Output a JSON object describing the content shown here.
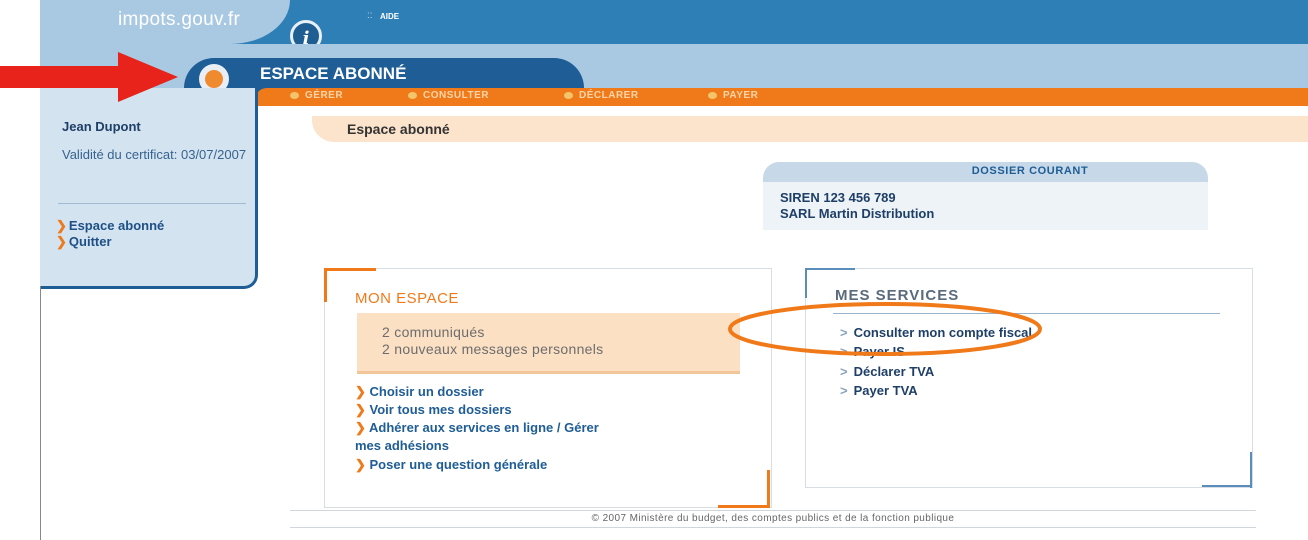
{
  "header": {
    "site_name": "impots.gouv.fr",
    "info_icon_glyph": "i",
    "aide_dots": "::",
    "aide_label": "AIDE"
  },
  "espace": {
    "title": "ESPACE ABONNÉ"
  },
  "menu": {
    "items": [
      {
        "label": "GÉRER"
      },
      {
        "label": "CONSULTER"
      },
      {
        "label": "DÉCLARER"
      },
      {
        "label": "PAYER"
      }
    ]
  },
  "sidebar": {
    "user_name": "Jean Dupont",
    "validity": "Validité du certificat: 03/07/2007",
    "links": [
      {
        "label": "Espace abonné"
      },
      {
        "label": "Quitter"
      }
    ]
  },
  "breadcrumb": {
    "label": "Espace abonné"
  },
  "dossier": {
    "title": "DOSSIER COURANT",
    "siren": "SIREN 123 456 789",
    "company": "SARL Martin Distribution"
  },
  "mon_espace": {
    "title": "MON ESPACE",
    "notifications": [
      "2 communiqués",
      "2 nouveaux messages personnels"
    ],
    "links": [
      "Choisir un dossier",
      "Voir tous mes dossiers",
      "Adhérer aux services en ligne / Gérer",
      "mes adhésions",
      "Poser une question générale"
    ]
  },
  "mes_services": {
    "title": "MES SERVICES",
    "links": [
      "Consulter mon compte fiscal",
      "Payer IS",
      "Déclarer TVA",
      "Payer TVA"
    ]
  },
  "footer": {
    "text": "© 2007 Ministère du budget, des comptes publics et de la fonction publique"
  },
  "colors": {
    "brand_blue": "#1e5d95",
    "accent_orange": "#f07a1a",
    "annotation_red": "#e8231b"
  }
}
